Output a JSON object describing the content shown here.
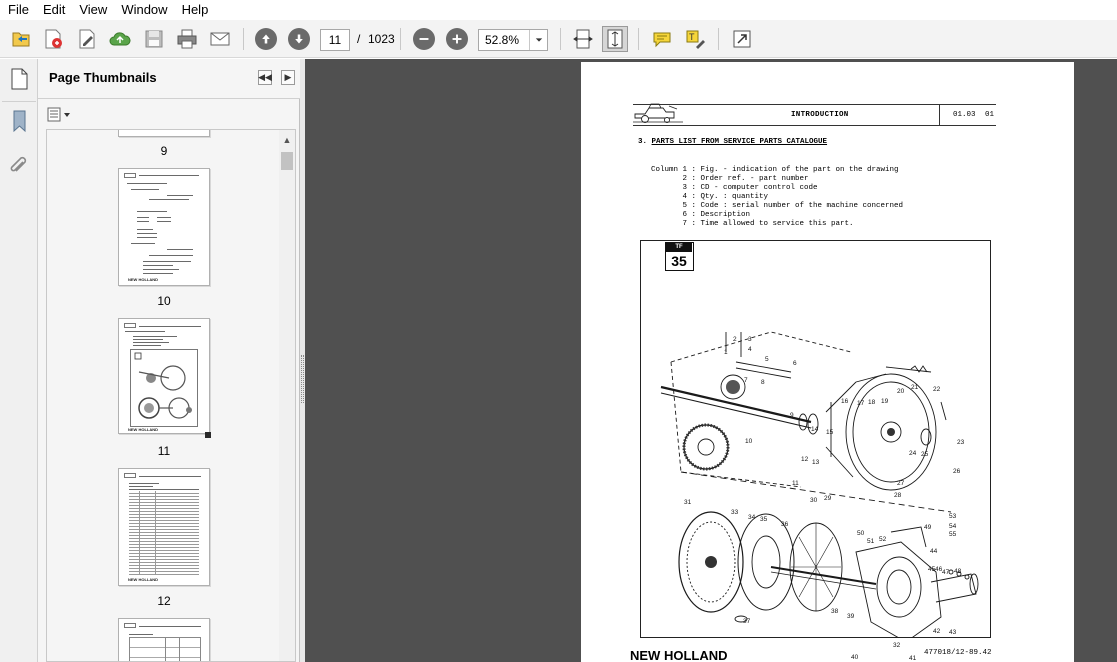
{
  "menubar": {
    "items": [
      "File",
      "Edit",
      "View",
      "Window",
      "Help"
    ]
  },
  "toolbar": {
    "current_page": "11",
    "page_separator": "/",
    "page_total": "1023",
    "zoom": "52.8%",
    "icons": [
      "open-icon",
      "create-pdf-icon",
      "edit-icon",
      "cloud-upload-icon",
      "save-icon",
      "print-icon",
      "email-icon",
      "previous-page-icon",
      "next-page-icon",
      "zoom-out-icon",
      "zoom-in-icon",
      "zoom-dropdown-icon",
      "fit-width-icon",
      "fit-page-icon",
      "comment-icon",
      "highlight-icon",
      "full-screen-icon"
    ]
  },
  "sidebar": {
    "title": "Page Thumbnails",
    "thumbnails": [
      {
        "label": "9"
      },
      {
        "label": "10"
      },
      {
        "label": "11",
        "selected": true
      },
      {
        "label": "12"
      }
    ]
  },
  "document": {
    "header_title": "INTRODUCTION",
    "header_code": "01.03",
    "header_page": "01",
    "section_number": "3.",
    "section_title": "PARTS LIST FROM SERVICE PARTS CATALOGUE",
    "column_lines": [
      "Column 1 : Fig. - indication of the part on the drawing",
      "       2 : Order ref. - part number",
      "       3 : CD - computer control code",
      "       4 : Qty. : quantity",
      "       5 : Code : serial number of the machine concerned",
      "       6 : Description",
      "       7 : Time allowed to service this part."
    ],
    "figure_tag": "TF",
    "figure_number": "35",
    "callouts": [
      "1",
      "2",
      "3",
      "4",
      "5",
      "6",
      "7",
      "8",
      "9",
      "10",
      "11",
      "12",
      "13",
      "14",
      "15",
      "16",
      "17",
      "18",
      "19",
      "20",
      "21",
      "22",
      "23",
      "24",
      "25",
      "26",
      "27",
      "28",
      "29",
      "30",
      "31",
      "32",
      "33",
      "34",
      "35",
      "36",
      "37",
      "38",
      "39",
      "40",
      "41",
      "42",
      "43",
      "44",
      "45",
      "46",
      "47",
      "48",
      "49",
      "50",
      "51",
      "52",
      "53",
      "54",
      "55"
    ],
    "brand": "NEW HOLLAND",
    "doc_ref": "477018/12-89.42"
  }
}
